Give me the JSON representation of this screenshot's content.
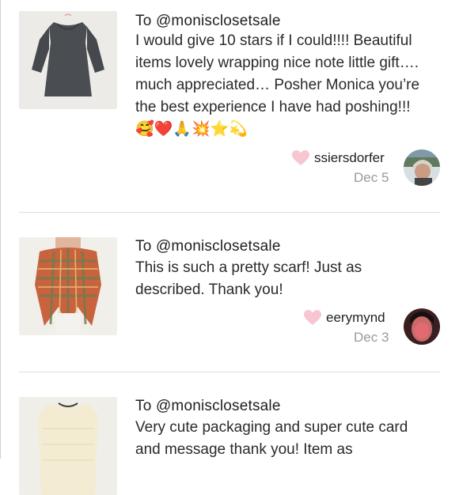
{
  "reviews": [
    {
      "to": "To @monisclosetsale",
      "text": "I would give 10 stars if I could!!!! Beautiful items lovely wrapping nice note little gift…. much appreciated… Posher Monica you’re the best experience I have had poshing!!!🥰❤️🙏💥⭐️💫",
      "username": "ssiersdorfer",
      "date": "Dec 5",
      "item_icon": "gray-dress-image",
      "avatar_icon": "user-avatar-image"
    },
    {
      "to": "To @monisclosetsale",
      "text": "This is such a pretty scarf! Just as described. Thank you!",
      "username": "eerymynd",
      "date": "Dec 3",
      "item_icon": "plaid-scarf-image",
      "avatar_icon": "user-avatar-image"
    },
    {
      "to": "To @monisclosetsale",
      "text": "Very cute packaging and super cute card and message thank you! Item as",
      "item_icon": "cream-sweater-image"
    }
  ],
  "colors": {
    "heart": "#f7c6d0",
    "date": "#9a9a9a",
    "divider": "#dedede"
  }
}
